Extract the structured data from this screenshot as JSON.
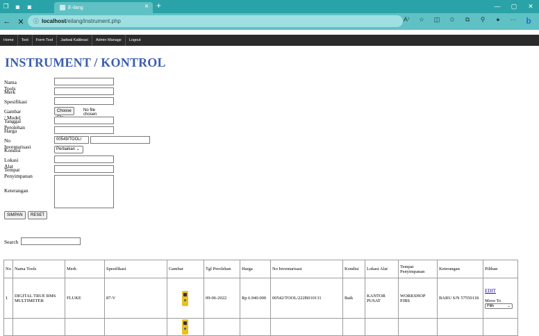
{
  "browser": {
    "tab_title": "E-ilang",
    "url_host": "localhost",
    "url_path": "/eilang/instrument.php"
  },
  "nav": {
    "items": [
      "Home",
      "Tool",
      "Form Tool",
      "Jadwal Kalibrasi",
      "Admin Manage",
      "Logout"
    ]
  },
  "page": {
    "title": "INSTRUMENT / KONTROL"
  },
  "form": {
    "nama_tools_label": "Nama Tools",
    "merk_label": "Merk",
    "spesifikasi_label": "Spesifikasi",
    "gambar_label": "Gambar / Model",
    "choose_file_label": "Choose File",
    "no_file_text": "No file chosen",
    "tanggal_label": "Tanggal Perolehan",
    "harga_label": "Harga",
    "no_inventaris_label": "No Inventarisasi",
    "no_inventaris_prefix": "00549/TOOL/",
    "kondisi_label": "Kondisi",
    "kondisi_value": "Perbaikan",
    "lokasi_label": "Lokasi Alat",
    "tempat_label": "Tempat Penyimpanan",
    "keterangan_label": "Keterangan",
    "simpan_label": "SIMPAN",
    "reset_label": "RESET",
    "search_label": "Search"
  },
  "table": {
    "headers": [
      "No",
      "Nama Tools",
      "Merk",
      "Spesifikasi",
      "Gambar",
      "Tgl Perolehan",
      "Harga",
      "No Inventarisasi",
      "Kondisi",
      "Lokasi Alat",
      "Tempat Penyimpanan",
      "Keterangan",
      "Pilihan"
    ],
    "rows": [
      {
        "no": "1",
        "nama": "DIGITAL TRUE RMS MULTIMETER",
        "merk": "FLUKE",
        "spesifikasi": "87-V",
        "tgl": "09-06-2022",
        "harga": "Rp 6.940.000",
        "inventaris": "00542/TOOL/222B010131",
        "kondisi": "Baik",
        "lokasi": "KANTOR PUSAT",
        "tempat": "WORKSHOP PJBS",
        "keterangan": "BARU S/N 57550118",
        "edit": "EDIT",
        "move_to": "Move To",
        "pilih": "Pilih"
      }
    ]
  },
  "colors": {
    "title": "#3b5db0",
    "browser_chrome": "#2aa3a8",
    "address_bar": "#5fc1c4"
  }
}
